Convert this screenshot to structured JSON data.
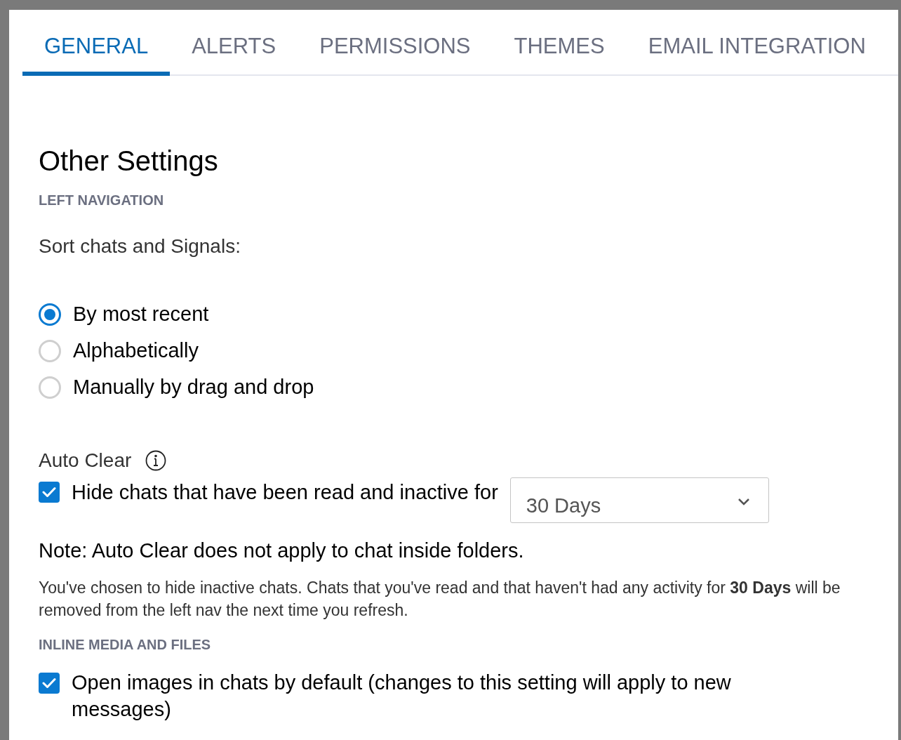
{
  "tabs": [
    {
      "label": "GENERAL",
      "selected": true
    },
    {
      "label": "ALERTS",
      "selected": false
    },
    {
      "label": "PERMISSIONS",
      "selected": false
    },
    {
      "label": "THEMES",
      "selected": false
    },
    {
      "label": "EMAIL INTEGRATION",
      "selected": false
    }
  ],
  "heading": "Other Settings",
  "left_navigation": {
    "label": "LEFT NAVIGATION",
    "sort_label": "Sort chats and Signals:",
    "options": [
      {
        "label": "By most recent",
        "selected": true
      },
      {
        "label": "Alphabetically",
        "selected": false
      },
      {
        "label": "Manually by drag and drop",
        "selected": false
      }
    ]
  },
  "auto_clear": {
    "label": "Auto Clear",
    "hide_checkbox": {
      "label": "Hide chats that have been read and inactive for",
      "checked": true
    },
    "duration": {
      "value": "30 Days"
    },
    "note": "Note: Auto Clear does not apply to chat inside folders.",
    "explanation": "You've chosen to hide inactive chats. Chats that you've read and that haven't had any activity for **30 Days** will be removed from the left nav the next time you refresh."
  },
  "inline_media": {
    "label": "INLINE MEDIA AND FILES",
    "open_images": {
      "label": "Open images in chats by default (changes to this setting will apply to new messages)",
      "checked": true
    }
  }
}
